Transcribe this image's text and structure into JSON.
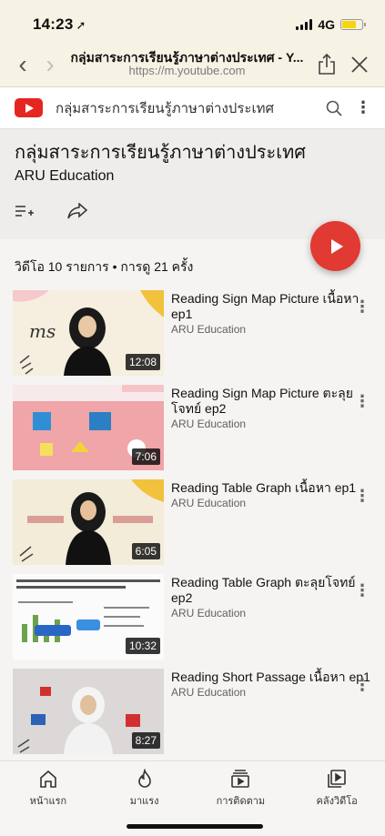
{
  "status": {
    "time": "14:23",
    "network": "4G"
  },
  "browser": {
    "page_title": "กลุ่มสาระการเรียนรู้ภาษาต่างประเทศ - Y...",
    "domain": "https://m.youtube.com"
  },
  "yt_header": {
    "title": "กลุ่มสาระการเรียนรู้ภาษาต่างประเทศ"
  },
  "playlist": {
    "title": "กลุ่มสาระการเรียนรู้ภาษาต่างประเทศ",
    "channel": "ARU Education",
    "stats": "วิดีโอ 10 รายการ • การดู 21 ครั้ง"
  },
  "videos": [
    {
      "title": "Reading Sign Map Picture เนื้อหา ep1",
      "channel": "ARU Education",
      "duration": "12:08"
    },
    {
      "title": "Reading Sign Map Picture ตะลุยโจทย์ ep2",
      "channel": "ARU Education",
      "duration": "7:06"
    },
    {
      "title": "Reading Table Graph เนื้อหา ep1",
      "channel": "ARU Education",
      "duration": "6:05"
    },
    {
      "title": "Reading Table Graph ตะลุยโจทย์ ep2",
      "channel": "ARU Education",
      "duration": "10:32"
    },
    {
      "title": "Reading Short Passage เนื้อหา ep1",
      "channel": "ARU Education",
      "duration": "8:27"
    }
  ],
  "bottom_nav": [
    {
      "label": "หน้าแรก",
      "icon": "home-icon"
    },
    {
      "label": "มาแรง",
      "icon": "explore-icon"
    },
    {
      "label": "การติดตาม",
      "icon": "subscriptions-icon"
    },
    {
      "label": "คลังวิดีโอ",
      "icon": "library-icon"
    }
  ]
}
